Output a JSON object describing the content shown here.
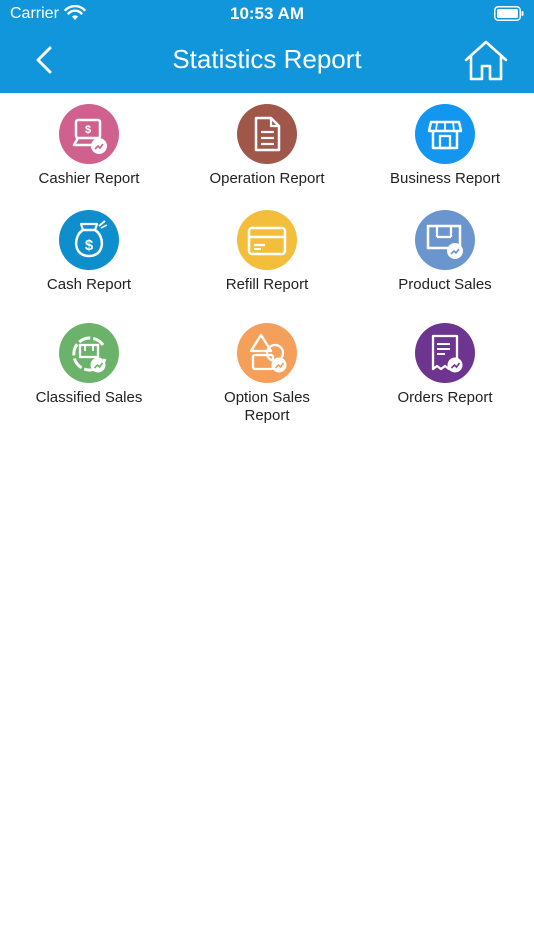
{
  "status_bar": {
    "carrier": "Carrier",
    "time": "10:53 AM"
  },
  "nav": {
    "title": "Statistics Report",
    "back_icon": "chevron-left-icon",
    "home_icon": "home-icon"
  },
  "colors": {
    "nav_bg": "#1296db",
    "cashier": "#d0608e",
    "operation": "#a0574a",
    "business": "#1296f0",
    "cash": "#0e8ecd",
    "refill": "#f2be3c",
    "product": "#6b95cf",
    "classified": "#6bb36b",
    "option": "#f5a05a",
    "orders": "#6e3590"
  },
  "reports": [
    {
      "label": "Cashier Report",
      "icon": "cashier-report-icon"
    },
    {
      "label": "Operation Report",
      "icon": "operation-report-icon"
    },
    {
      "label": "Business Report",
      "icon": "business-report-icon"
    },
    {
      "label": "Cash Report",
      "icon": "cash-report-icon"
    },
    {
      "label": "Refill Report",
      "icon": "refill-report-icon"
    },
    {
      "label": "Product Sales",
      "icon": "product-sales-icon"
    },
    {
      "label": "Classified Sales",
      "icon": "classified-sales-icon"
    },
    {
      "label": "Option Sales\nReport",
      "icon": "option-sales-report-icon"
    },
    {
      "label": "Orders Report",
      "icon": "orders-report-icon"
    }
  ]
}
